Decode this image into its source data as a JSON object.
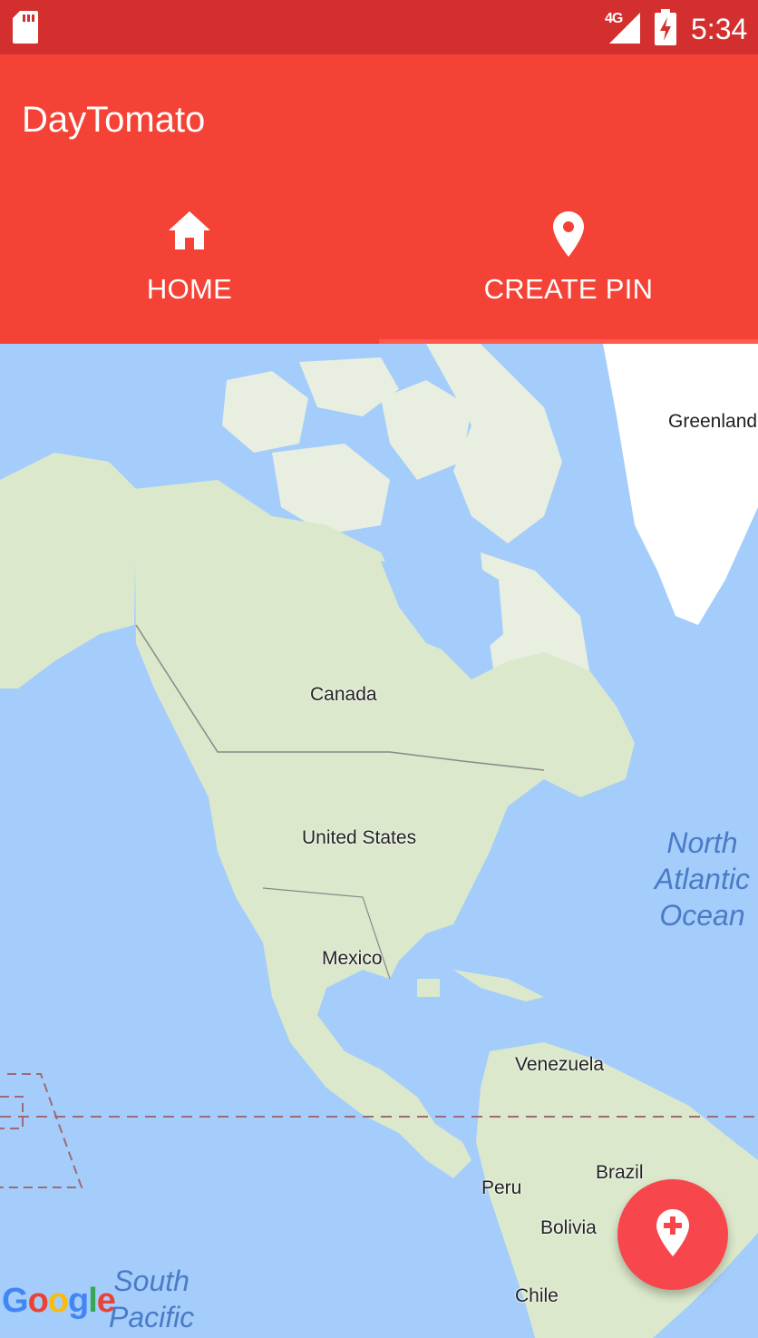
{
  "status_bar": {
    "network_label": "4G",
    "time": "5:34",
    "icons": [
      "sd-card-icon",
      "signal-icon",
      "battery-charging-icon"
    ]
  },
  "app_bar": {
    "title": "DayTomato",
    "background_color": "#f44336",
    "tabs": [
      {
        "label": "HOME",
        "icon": "home-icon",
        "selected": false
      },
      {
        "label": "CREATE PIN",
        "icon": "location-pin-icon",
        "selected": true
      }
    ]
  },
  "map": {
    "place_labels": {
      "greenland": "Greenland",
      "canada": "Canada",
      "united_states": "United States",
      "mexico": "Mexico",
      "venezuela": "Venezuela",
      "peru": "Peru",
      "brazil": "Brazil",
      "bolivia": "Bolivia",
      "chile": "Chile"
    },
    "ocean_labels": {
      "north_atlantic": "North\nAtlantic\nOcean",
      "south_pacific": "South\nPacific"
    },
    "attribution": "Google",
    "water_color": "#a4cdfb",
    "land_color": "#dfeccf"
  },
  "fab": {
    "icon": "add-location-icon",
    "color": "#f7474d"
  }
}
